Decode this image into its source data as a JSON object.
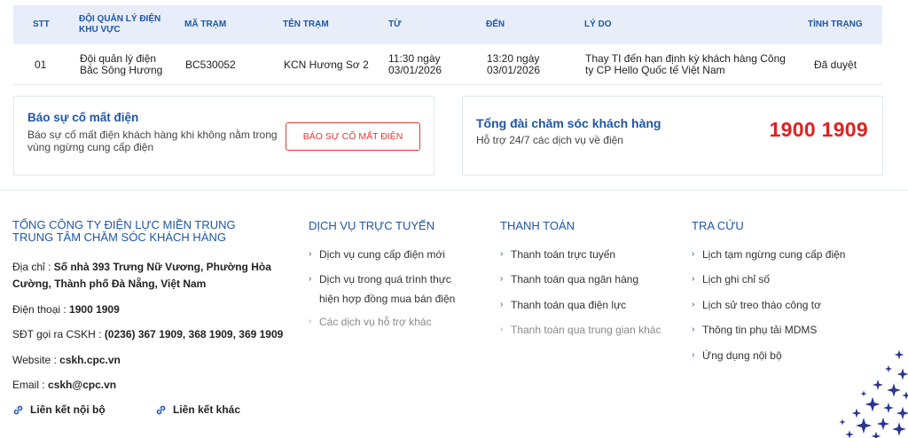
{
  "table": {
    "headers": {
      "stt": "STT",
      "doi_quan_ly_1": "ĐỘI QUẢN LÝ ĐIỆN",
      "doi_quan_ly_2": "KHU VỰC",
      "ma_tram": "MÃ TRẠM",
      "ten_tram": "TÊN TRẠM",
      "tu": "TỪ",
      "den": "ĐẾN",
      "ly_do": "LÝ DO",
      "tinh_trang": "TÌNH TRẠNG"
    },
    "rows": [
      {
        "stt": "01",
        "doi_1": "Đội quản lý điện",
        "doi_2": "Bắc Sông Hương",
        "ma_tram": "BC530052",
        "ten_tram": "KCN Hương Sơ 2",
        "tu_1": "11:30 ngày",
        "tu_2": "03/01/2026",
        "den_1": "13:20 ngày",
        "den_2": "03/01/2026",
        "ly_do_1": "Thay TI đến hạn định kỳ khách hàng Công",
        "ly_do_2": "ty CP Hello Quốc tế Việt Nam",
        "tinh_trang": "Đã duyệt"
      }
    ]
  },
  "report_card": {
    "title": "Báo sự cố mất điện",
    "desc_1": "Báo sự cố mất điện khách hàng khi không nằm trong",
    "desc_2": "vùng ngừng cung cấp điện",
    "button": "BÁO SỰ CỐ MẤT ĐIỆN"
  },
  "hotline_card": {
    "title": "Tổng đài chăm sóc khách hàng",
    "desc": "Hỗ trợ 24/7 các dịch vụ về điện",
    "number": "1900 1909"
  },
  "footer": {
    "company_1": "TỔNG CÔNG TY ĐIỆN LỰC MIỀN TRUNG",
    "company_2": "TRUNG TÂM CHĂM SÓC KHÁCH HÀNG",
    "address_label": "Địa chỉ : ",
    "address_1": "Số nhà 393 Trưng Nữ Vương, Phường Hòa",
    "address_2": "Cường, Thành phố Đà Nẵng, Việt Nam",
    "phone_label": "Điện thoại : ",
    "phone": "1900 1909",
    "cskh_label": "SĐT gọi ra CSKH : ",
    "cskh": "(0236) 367 1909, 368 1909, 369 1909",
    "website_label": "Website : ",
    "website": "cskh.cpc.vn",
    "email_label": "Email : ",
    "email": "cskh@cpc.vn",
    "internal_links": "Liên kết nội bộ",
    "other_links": "Liên kết khác",
    "col_online": {
      "title": "DỊCH VỤ TRỰC TUYẾN",
      "item_1": "Dịch vụ cung cấp điện mới",
      "item_2a": "Dịch vụ trong quá trình thực",
      "item_2b": "hiện hợp đồng mua bán điện",
      "item_3": "Các dịch vụ hỗ trợ khác"
    },
    "col_payment": {
      "title": "THANH TOÁN",
      "item_1": "Thanh toán trực tuyến",
      "item_2": "Thanh toán qua ngân hàng",
      "item_3": "Thanh toán qua điện lực",
      "item_4": "Thanh toán qua trung gian khác"
    },
    "col_lookup": {
      "title": "TRA CỨU",
      "item_1": "Lịch tạm ngừng cung cấp điện",
      "item_2": "Lịch ghi chỉ số",
      "item_3": "Lịch sử treo tháo công tơ",
      "item_4": "Thông tin phụ tải MDMS",
      "item_5": "Ứng dụng nội bộ"
    }
  },
  "colors": {
    "brand_blue": "#1f56a8",
    "alert_red": "#e02020",
    "header_bg": "#e8eef9"
  }
}
